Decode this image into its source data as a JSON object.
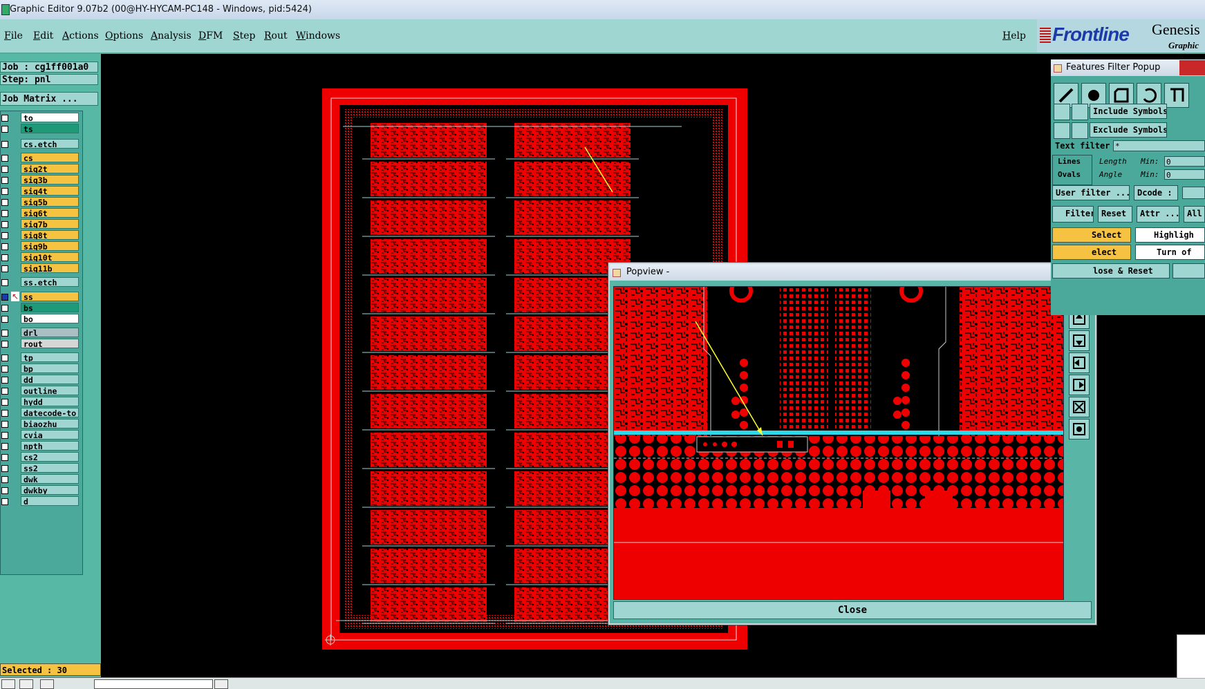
{
  "window": {
    "title": "Graphic Editor 9.07b2 (00@HY-HYCAM-PC148 - Windows, pid:5424)"
  },
  "menu": [
    "File",
    "Edit",
    "Actions",
    "Options",
    "Analysis",
    "DFM",
    "Step",
    "Rout",
    "Windows"
  ],
  "help": "Help",
  "logo": {
    "brand": "Frontline",
    "product": "Genesis",
    "sub": "Graphic"
  },
  "job": {
    "job": "Job : cg1ff001a0",
    "step": "Step: pnl",
    "matrix": "Job Matrix ..."
  },
  "layers": [
    {
      "name": "to",
      "color": "#ffffff"
    },
    {
      "name": "ts",
      "color": "#1f9a78"
    },
    {
      "name": "cs.etch",
      "color": "#9fd6d2"
    },
    {
      "name": "cs",
      "color": "#f5c242"
    },
    {
      "name": "sig2t",
      "color": "#f5c242"
    },
    {
      "name": "sig3b",
      "color": "#f5c242"
    },
    {
      "name": "sig4t",
      "color": "#f5c242"
    },
    {
      "name": "sig5b",
      "color": "#f5c242"
    },
    {
      "name": "sig6t",
      "color": "#f5c242"
    },
    {
      "name": "sig7b",
      "color": "#f5c242"
    },
    {
      "name": "sig8t",
      "color": "#f5c242"
    },
    {
      "name": "sig9b",
      "color": "#f5c242"
    },
    {
      "name": "sig10t",
      "color": "#f5c242"
    },
    {
      "name": "sig11b",
      "color": "#f5c242"
    },
    {
      "name": "ss.etch",
      "color": "#9fd6d2"
    },
    {
      "name": "ss",
      "color": "#f5c242"
    },
    {
      "name": "bs",
      "color": "#1f9a78"
    },
    {
      "name": "bo",
      "color": "#ffffff"
    },
    {
      "name": "drl",
      "color": "#a9bfc3"
    },
    {
      "name": "rout",
      "color": "#d6d6d6"
    },
    {
      "name": "tp",
      "color": "#9fd6d2"
    },
    {
      "name": "bp",
      "color": "#9fd6d2"
    },
    {
      "name": "dd",
      "color": "#9fd6d2"
    },
    {
      "name": "outline",
      "color": "#9fd6d2"
    },
    {
      "name": "hydd",
      "color": "#9fd6d2"
    },
    {
      "name": "datecode-to",
      "color": "#9fd6d2"
    },
    {
      "name": "biaozhu",
      "color": "#9fd6d2"
    },
    {
      "name": "cvia",
      "color": "#9fd6d2"
    },
    {
      "name": "npth",
      "color": "#9fd6d2"
    },
    {
      "name": "cs2",
      "color": "#9fd6d2"
    },
    {
      "name": "ss2",
      "color": "#9fd6d2"
    },
    {
      "name": "dwk",
      "color": "#9fd6d2"
    },
    {
      "name": "dwkby",
      "color": "#9fd6d2"
    },
    {
      "name": "d",
      "color": "#9fd6d2"
    }
  ],
  "status": {
    "selected": "Selected : 30"
  },
  "popview": {
    "title": "Popview - ",
    "close": "Close"
  },
  "features": {
    "title": "Features Filter Popup",
    "include": "Include Symbols :",
    "exclude": "Exclude Symbols :",
    "text_filter": "Text filter",
    "text_filter_value": "*",
    "lines": "Lines",
    "ovals": "Ovals",
    "length": "Length",
    "angle": "Angle",
    "min": "Min:",
    "min_val1": "0",
    "min_val2": "0",
    "user_filter": "User filter ...",
    "dcode": "Dcode :",
    "filter": "Filter",
    "reset": "Reset",
    "attr": "Attr ...",
    "all": "All",
    "select": "Select",
    "highlight": "Highligh",
    "unselect": "elect",
    "turn_off": "Turn of",
    "close_reset": "lose & Reset"
  }
}
